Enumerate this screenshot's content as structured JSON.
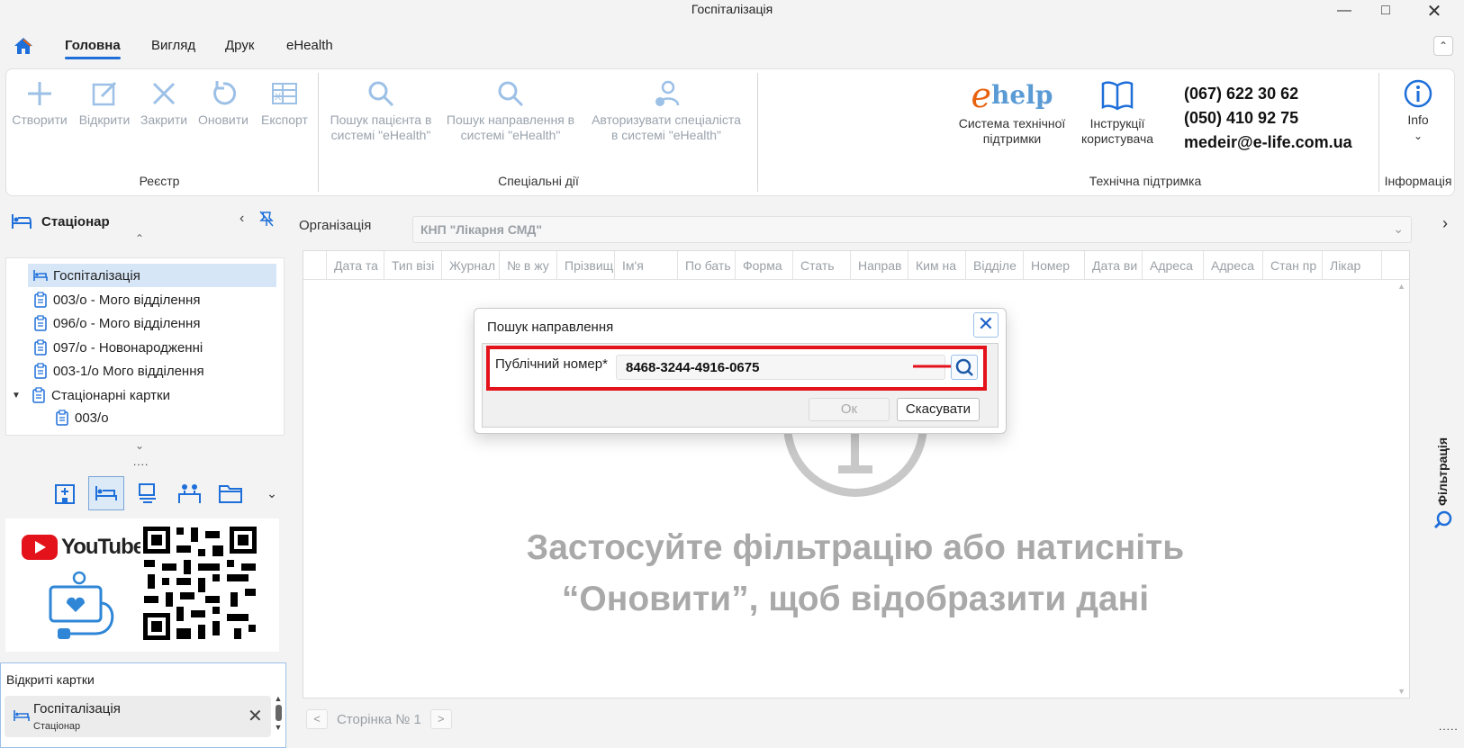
{
  "window": {
    "title": "Госпіталізація"
  },
  "menu": {
    "items": [
      "Головна",
      "Вигляд",
      "Друк",
      "eHealth"
    ]
  },
  "ribbon": {
    "registry": {
      "label": "Реєстр",
      "buttons": [
        "Створити",
        "Відкрити",
        "Закрити",
        "Оновити",
        "Експорт"
      ]
    },
    "special": {
      "label": "Спеціальні дії",
      "buttons": [
        {
          "line1": "Пошук пацієнта в",
          "line2": "системі \"eHealth\""
        },
        {
          "line1": "Пошук направлення в",
          "line2": "системі \"eHealth\""
        },
        {
          "line1": "Авторизувати спеціаліста",
          "line2": "в системі \"eHealth\""
        }
      ]
    },
    "support": {
      "label": "Технічна підтримка",
      "ehelp_logo": "help",
      "support_system": {
        "line1": "Система технічної",
        "line2": "підтримки"
      },
      "manuals": {
        "line1": "Інструкції",
        "line2": "користувача"
      },
      "phone1": "(067) 622 30 62",
      "phone2": "(050) 410 92 75",
      "email": "medeir@e-life.com.ua"
    },
    "info": {
      "label": "Інформація",
      "button": "Info"
    }
  },
  "sidebar": {
    "title": "Стаціонар",
    "tree": [
      "Госпіталізація",
      "003/о - Мого відділення",
      "096/о - Мого відділення",
      "097/о - Новонародженні",
      "003-1/о Мого відділення",
      "Стаціонарні картки",
      "003/о"
    ],
    "dots": "....",
    "promo": {
      "youtube": "YouTube"
    },
    "open_cards": {
      "title": "Відкриті картки",
      "item_title": "Госпіталізація",
      "item_subtitle": "Стаціонар"
    }
  },
  "main": {
    "org_label": "Організація",
    "org_value": "КНП \"Лікарня СМД\"",
    "columns": [
      "Дата та",
      "Тип візі",
      "Журнал",
      "№ в жу",
      "Прізвищ",
      "Ім'я",
      "По бать",
      "Форма",
      "Стать",
      "Направ",
      "Ким на",
      "Відділе",
      "Номер",
      "Дата ви",
      "Адреса",
      "Адреса",
      "Стан пр",
      "Лікар"
    ],
    "empty_line1": "Застосуйте фільтрацію або натисніть",
    "empty_line2": "“Оновити”, щоб відобразити дані",
    "pager": {
      "prev": "<",
      "page": "Сторінка № 1",
      "next": ">"
    },
    "filter_tab": "Фільтрація",
    "bottom_dots": "....."
  },
  "dialog": {
    "title": "Пошук направлення",
    "field_label": "Публічний номер*",
    "field_value": "8468-3244-4916-0675",
    "ok": "Ок",
    "cancel": "Скасувати"
  },
  "colors": {
    "accent": "#1e6fd9",
    "highlight": "#e3121b",
    "disabled": "#9aa3ad"
  }
}
